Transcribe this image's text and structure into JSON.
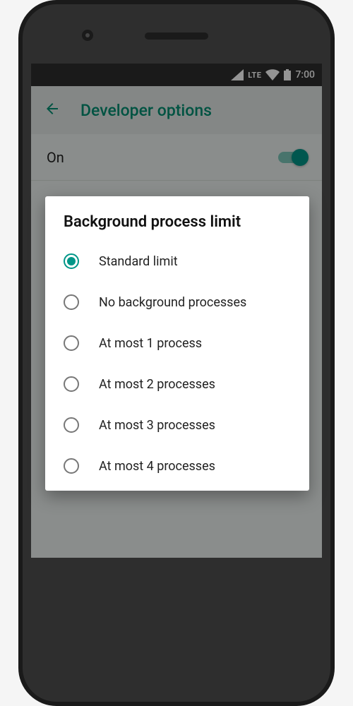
{
  "statusbar": {
    "network_label": "LTE",
    "time": "7:00"
  },
  "appbar": {
    "title": "Developer options"
  },
  "toggle": {
    "label": "On",
    "enabled": true
  },
  "dialog": {
    "title": "Background process limit",
    "selected_index": 0,
    "options": [
      {
        "label": "Standard limit"
      },
      {
        "label": "No background processes"
      },
      {
        "label": "At most 1 process"
      },
      {
        "label": "At most 2 processes"
      },
      {
        "label": "At most 3 processes"
      },
      {
        "label": "At most 4 processes"
      }
    ]
  }
}
